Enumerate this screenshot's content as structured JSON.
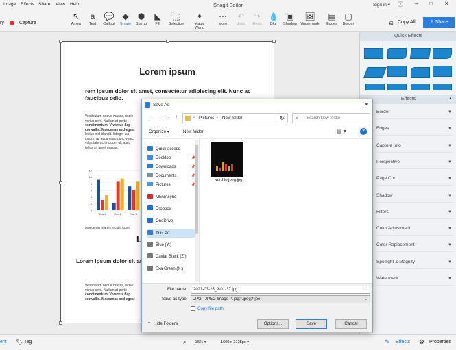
{
  "menubar": {
    "items": [
      "Image",
      "Effects",
      "Share",
      "View",
      "Help"
    ],
    "title": "Snagit Editor",
    "sign_in": "Sign in ▾"
  },
  "toolbar": {
    "left_trunc": "ry",
    "capture": "Capture",
    "tools": [
      {
        "label": "Arrow",
        "icon": "↖"
      },
      {
        "label": "Text",
        "icon": "a"
      },
      {
        "label": "Callout",
        "icon": "💬"
      },
      {
        "label": "Shape",
        "icon": "◆"
      },
      {
        "label": "Stamp",
        "icon": "⬢"
      },
      {
        "label": "Fill",
        "icon": "◣"
      },
      {
        "label": "Selection",
        "icon": "⬚"
      },
      {
        "label": "Magic Wand",
        "icon": "✦"
      },
      {
        "label": "More",
        "icon": "⋯"
      },
      {
        "label": "Undo",
        "icon": "↶"
      },
      {
        "label": "Redo",
        "icon": "↷"
      },
      {
        "label": "Blur",
        "icon": "💧"
      },
      {
        "label": "Shadow",
        "icon": "▣"
      },
      {
        "label": "Watermark",
        "icon": "🖼"
      },
      {
        "label": "Edges",
        "icon": "▤"
      },
      {
        "label": "Border",
        "icon": "▢"
      }
    ],
    "copy_all": "Copy All",
    "share": "Share"
  },
  "document": {
    "title": "Lorem ipsum",
    "heading": "rem ipsum dolor sit amet, consectetur adipiscing elit. Nunc ac faucibus odio.",
    "para1_lines": [
      "Vestibulum neque massa, scele",
      "varius sem. Nullam at portti",
      "condimentum. Vivamus dap",
      "convallis. Maecenas sed egest",
      "lectus nisl blandit. Integer lac",
      "ipsum, ac accumsan nunc vehic",
      "vulputate ac tincidunt ut, auct",
      "tellus sit amet massa."
    ],
    "caption": "Maecenas mauris lectus, lobor",
    "big_l": "L",
    "heading2": "Lorem ipsum dolor sit amet, consectet Nunc ac faucibus od",
    "para2_lines": [
      "Vestibulum neque massa, scele",
      "varius sem. Nullam at portti",
      "condimentum. Vivamus dap",
      "convallis. Maecenas sed egest"
    ]
  },
  "chart_data": {
    "type": "bar",
    "categories": [
      "Row 1",
      "Row 2",
      "Row 3"
    ],
    "series": [
      {
        "values": [
          9.2,
          2.3,
          7.2
        ]
      },
      {
        "values": [
          3.1,
          8.8,
          6.1
        ]
      },
      {
        "values": [
          4.5,
          9.6,
          8.8
        ]
      }
    ],
    "ylim": [
      0,
      12
    ],
    "yticks": [
      "0",
      "2",
      "4",
      "6",
      "8",
      "10",
      "12"
    ],
    "colors": [
      "#1f4e9c",
      "#e3382a",
      "#f0b020"
    ]
  },
  "sidebar": {
    "quick_effects": "Quick Effects",
    "effects_header": "Effects",
    "effects": [
      "Border",
      "Edges",
      "Capture Info",
      "Perspective",
      "Page Curl",
      "Shadow",
      "Filters",
      "Color Adjustment",
      "Color Replacement",
      "Spotlight & Magnify",
      "Watermark"
    ]
  },
  "statusbar": {
    "left": "ent",
    "tag": "Tag",
    "zoom": "35% ▾",
    "dims": "1600 x 2128px ▾",
    "effects": "Effects",
    "properties": "Properties"
  },
  "dialog": {
    "title": "Save As",
    "path_prefix": "«",
    "path": [
      "Pictures",
      "New folder"
    ],
    "search_placeholder": "Search New folder",
    "organize": "Organize ▾",
    "new_folder": "New folder",
    "nav": [
      {
        "label": "Quick access",
        "color": "#2a7fd4",
        "pin": false
      },
      {
        "label": "Desktop",
        "color": "#3d8fe0",
        "pin": true
      },
      {
        "label": "Downloads",
        "color": "#2a7fd4",
        "pin": true
      },
      {
        "label": "Documents",
        "color": "#7a8fa8",
        "pin": true
      },
      {
        "label": "Pictures",
        "color": "#4a9ad8",
        "pin": true
      },
      {
        "label": "MEGAsync",
        "color": "#d9272e",
        "pin": false
      },
      {
        "label": "Dropbox",
        "color": "#1e6fd9",
        "pin": false
      },
      {
        "label": "OneDrive",
        "color": "#1e6fd9",
        "pin": false
      },
      {
        "label": "This PC",
        "color": "#3a7bd5",
        "pin": false
      },
      {
        "label": "Blue (Y:)",
        "color": "#777",
        "pin": false
      },
      {
        "label": "Caviar Black (Z:)",
        "color": "#777",
        "pin": false
      },
      {
        "label": "Exa Green (X:)",
        "color": "#777",
        "pin": false
      }
    ],
    "file_name": "word to jpeg.jpg",
    "file_name_label": "File name:",
    "file_name_value": "2021-03-25_9-01-37.jpg",
    "save_type_label": "Save as type:",
    "save_type_value": "JPG - JPEG Image (*.jpg;*.jpeg;*.jpe)",
    "copy_path": "Copy file path",
    "hide_folders": "Hide Folders",
    "options": "Options...",
    "save": "Save",
    "cancel": "Cancel",
    "close": "✕"
  }
}
